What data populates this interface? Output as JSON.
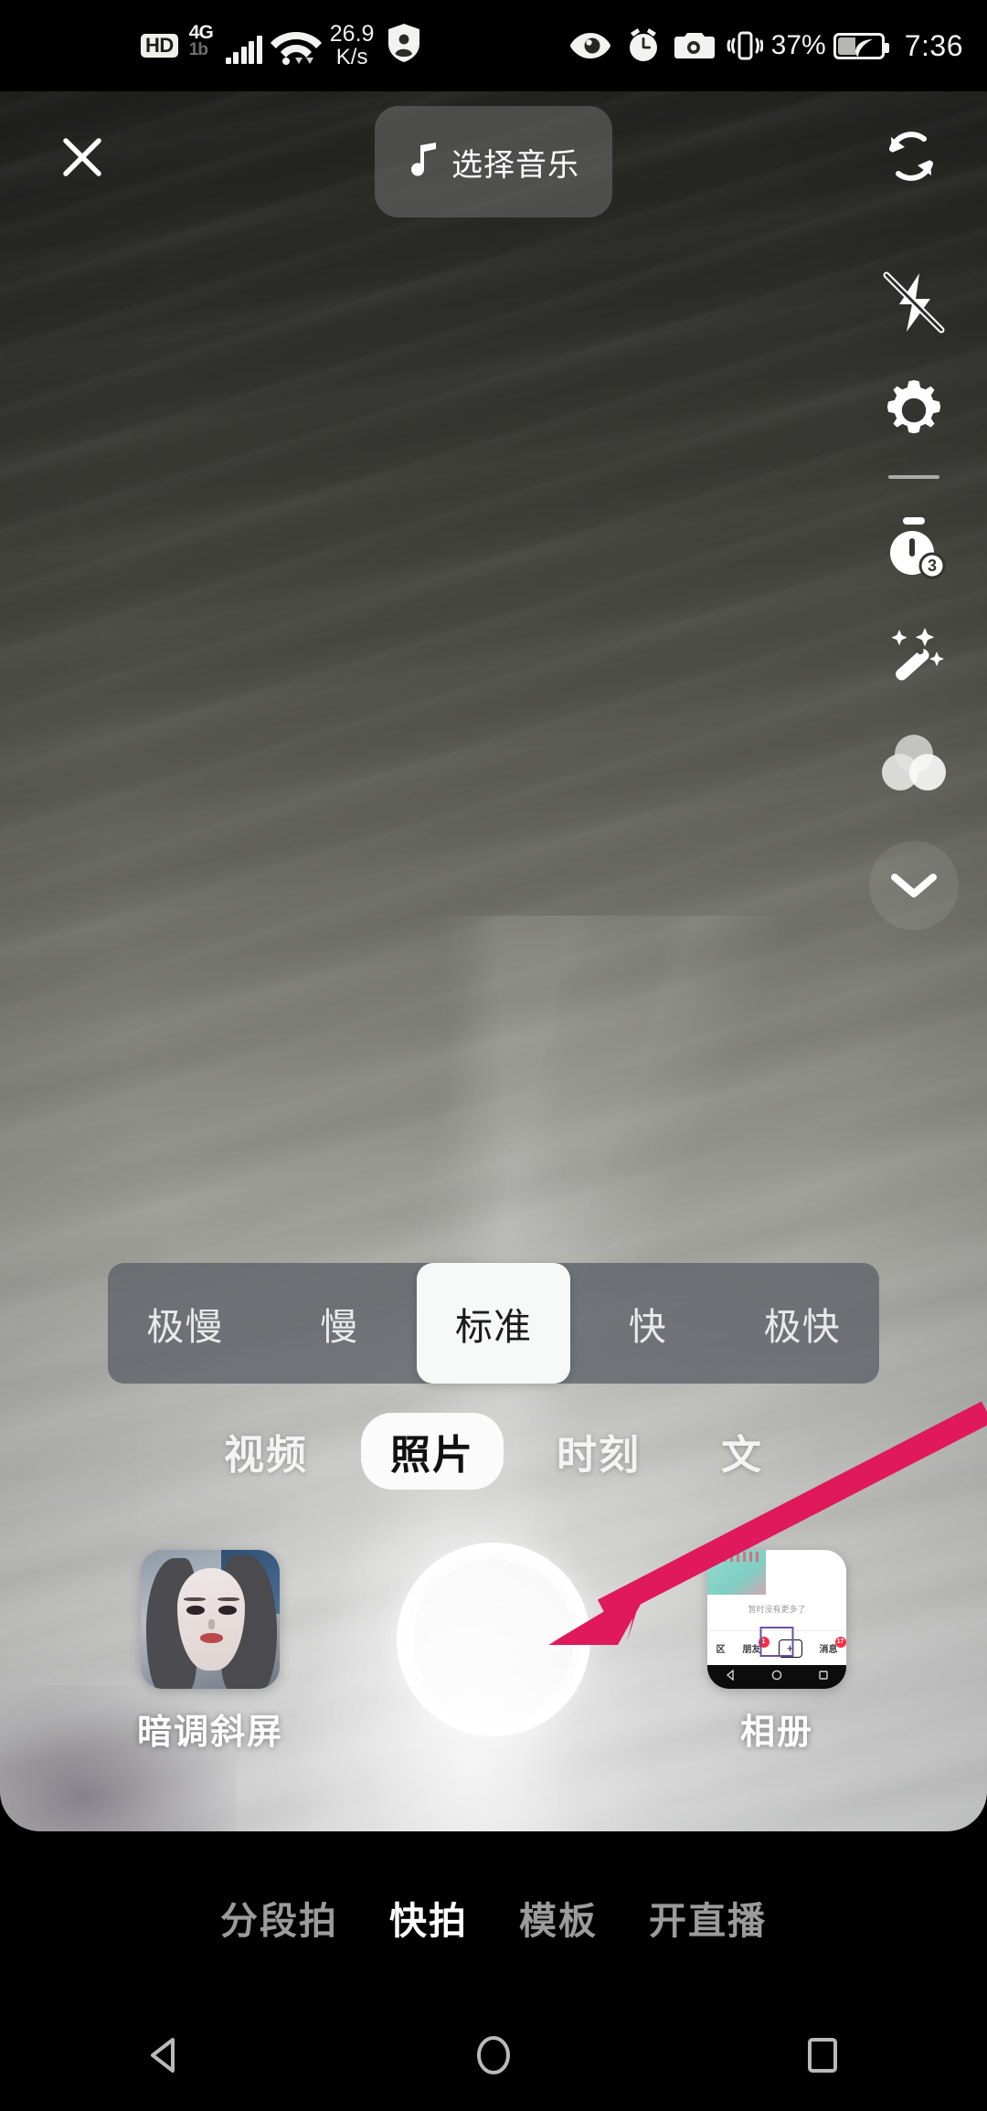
{
  "statusbar": {
    "hd_badge": "HD",
    "network_label": "4G",
    "network_sub": "1b",
    "net_speed_value": "26.9",
    "net_speed_unit": "K/s",
    "icons_left": [
      "hd-badge",
      "signal-bars-icon",
      "wifi-icon",
      "privacy-shield-icon"
    ],
    "icons_right": [
      "eye-icon",
      "alarm-clock-icon",
      "camera-icon",
      "vibrate-icon",
      "battery-icon"
    ],
    "battery_percent": "37%",
    "clock": "7:36"
  },
  "toolbar": {
    "close_label": "✕",
    "close_icon": "close-icon",
    "music_label": "选择音乐",
    "music_icon": "music-note-icon",
    "flip_icon": "camera-flip-icon"
  },
  "rightrail": {
    "items": [
      {
        "icon": "flash-off-icon",
        "name": "flash-toggle"
      },
      {
        "icon": "gear-icon",
        "name": "settings"
      },
      {
        "icon": "timer-icon",
        "name": "countdown-timer",
        "badge": "3"
      },
      {
        "icon": "magic-wand-icon",
        "name": "beautify"
      },
      {
        "icon": "filter-circles-icon",
        "name": "filters"
      }
    ],
    "collapse_icon": "chevron-down-icon"
  },
  "speedbar": {
    "options": [
      {
        "label": "极慢",
        "active": false
      },
      {
        "label": "慢",
        "active": false
      },
      {
        "label": "标准",
        "active": true
      },
      {
        "label": "快",
        "active": false
      },
      {
        "label": "极快",
        "active": false
      }
    ]
  },
  "modetabs": {
    "tabs": [
      {
        "label": "视频",
        "active": false
      },
      {
        "label": "照片",
        "active": true
      },
      {
        "label": "时刻",
        "active": false
      },
      {
        "label": "文",
        "active": false
      }
    ]
  },
  "capture": {
    "effect": {
      "label": "暗调斜屏",
      "thumb_name": "effect-thumbnail-portrait"
    },
    "shutter_name": "shutter-button",
    "album": {
      "label": "相册",
      "thumb_name": "album-thumbnail",
      "inner": {
        "empty_text": "暂时没有更多了",
        "nav_left_partial": "区",
        "nav_friends": "朋友",
        "nav_friends_badge": "1",
        "nav_plus": "+",
        "nav_messages": "消息",
        "nav_messages_badge": "17"
      }
    }
  },
  "annotation": {
    "arrow_color": "#e0185c",
    "arrow_name": "pink-pointer-arrow",
    "points_to": "shutter-button"
  },
  "bottomnav": {
    "items": [
      {
        "label": "分段拍",
        "active": false
      },
      {
        "label": "快拍",
        "active": true
      },
      {
        "label": "模板",
        "active": false
      },
      {
        "label": "开直播",
        "active": false
      }
    ]
  },
  "androidnav": {
    "back_icon": "back-triangle-icon",
    "home_icon": "home-circle-icon",
    "recents_icon": "recents-square-icon"
  },
  "colors": {
    "accent_pink": "#e0185c",
    "badge_red": "#fb2c48",
    "pill_gray": "rgba(92,96,102,0.78)",
    "active_white": "#f7f8f8"
  }
}
